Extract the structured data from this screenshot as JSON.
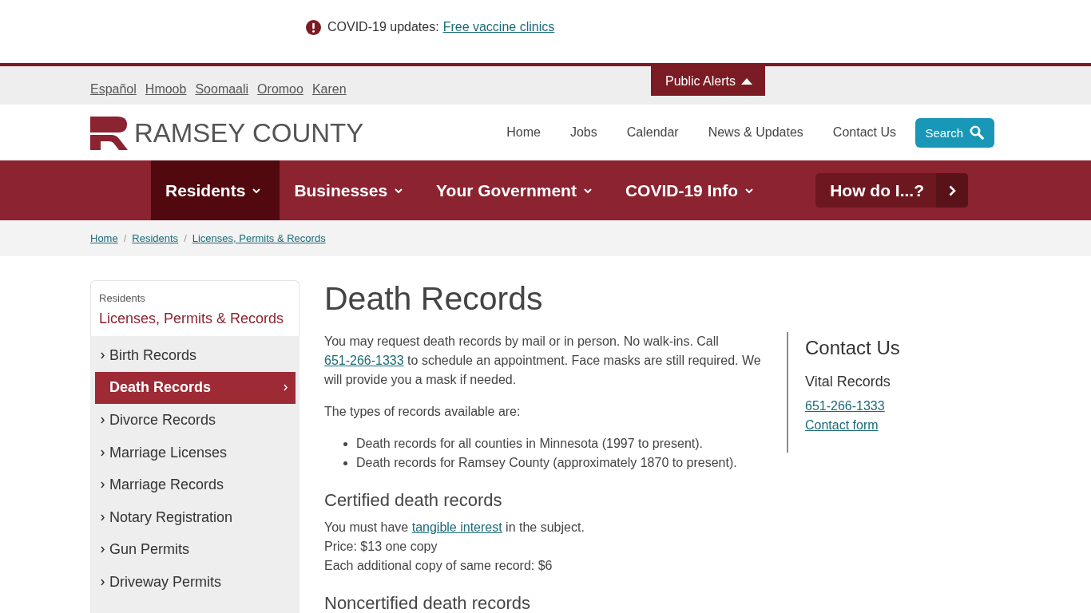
{
  "alert_bar": {
    "label": "COVID-19 updates:",
    "link": "Free vaccine clinics"
  },
  "language_links": [
    "Español",
    "Hmoob",
    "Soomaali",
    "Oromoo",
    "Karen"
  ],
  "public_alerts": {
    "label": "Public Alerts"
  },
  "header": {
    "logo_text": "RAMSEY COUNTY",
    "links": [
      "Home",
      "Jobs",
      "Calendar",
      "News & Updates",
      "Contact Us"
    ],
    "search_button": "Search"
  },
  "main_nav": {
    "items": [
      {
        "label": "Residents",
        "selected": true
      },
      {
        "label": "Businesses",
        "selected": false
      },
      {
        "label": "Your Government",
        "selected": false
      },
      {
        "label": "COVID-19 Info",
        "selected": false
      }
    ],
    "how_do_i": "How do I...?"
  },
  "breadcrumb": {
    "separator": "/",
    "items": [
      "Home",
      "Residents",
      "Licenses, Permits & Records"
    ]
  },
  "sidebar": {
    "parent": "Residents",
    "title": "Licenses, Permits & Records",
    "items": [
      {
        "label": "Birth Records",
        "selected": false
      },
      {
        "label": "Death Records",
        "selected": true
      },
      {
        "label": "Divorce Records",
        "selected": false
      },
      {
        "label": "Marriage Licenses",
        "selected": false
      },
      {
        "label": "Marriage Records",
        "selected": false
      },
      {
        "label": "Notary Registration",
        "selected": false
      },
      {
        "label": "Gun Permits",
        "selected": false
      },
      {
        "label": "Driveway Permits",
        "selected": false
      }
    ]
  },
  "content": {
    "title": "Death Records",
    "blocks": [
      {
        "kind": "paragraph",
        "segments": [
          {
            "kind": "text",
            "text": "You may request death records by mail or in person. No walk-ins. Call "
          },
          {
            "kind": "link",
            "text": "651-266-1333"
          },
          {
            "kind": "text",
            "text": " to schedule an appointment. Face masks are still required. We will provide you a mask if needed."
          }
        ]
      },
      {
        "kind": "paragraph",
        "segments": [
          {
            "kind": "text",
            "text": "The types of records available are:"
          }
        ]
      },
      {
        "kind": "list",
        "items": [
          "Death records for all counties in Minnesota (1997 to present).",
          "Death records for Ramsey County (approximately 1870 to present)."
        ]
      },
      {
        "kind": "heading",
        "text": "Certified death records"
      },
      {
        "kind": "lines",
        "lines": [
          [
            {
              "kind": "text",
              "text": "You must have "
            },
            {
              "kind": "link",
              "text": "tangible interest"
            },
            {
              "kind": "text",
              "text": " in the subject."
            }
          ],
          [
            {
              "kind": "text",
              "text": "Price: $13 one copy"
            }
          ],
          [
            {
              "kind": "text",
              "text": "Each additional copy of same record: $6"
            }
          ]
        ]
      },
      {
        "kind": "heading",
        "text": "Noncertified death records"
      }
    ]
  },
  "contact": {
    "title": "Contact Us",
    "subtitle": "Vital Records",
    "links": [
      "651-266-1333",
      "Contact form"
    ]
  }
}
